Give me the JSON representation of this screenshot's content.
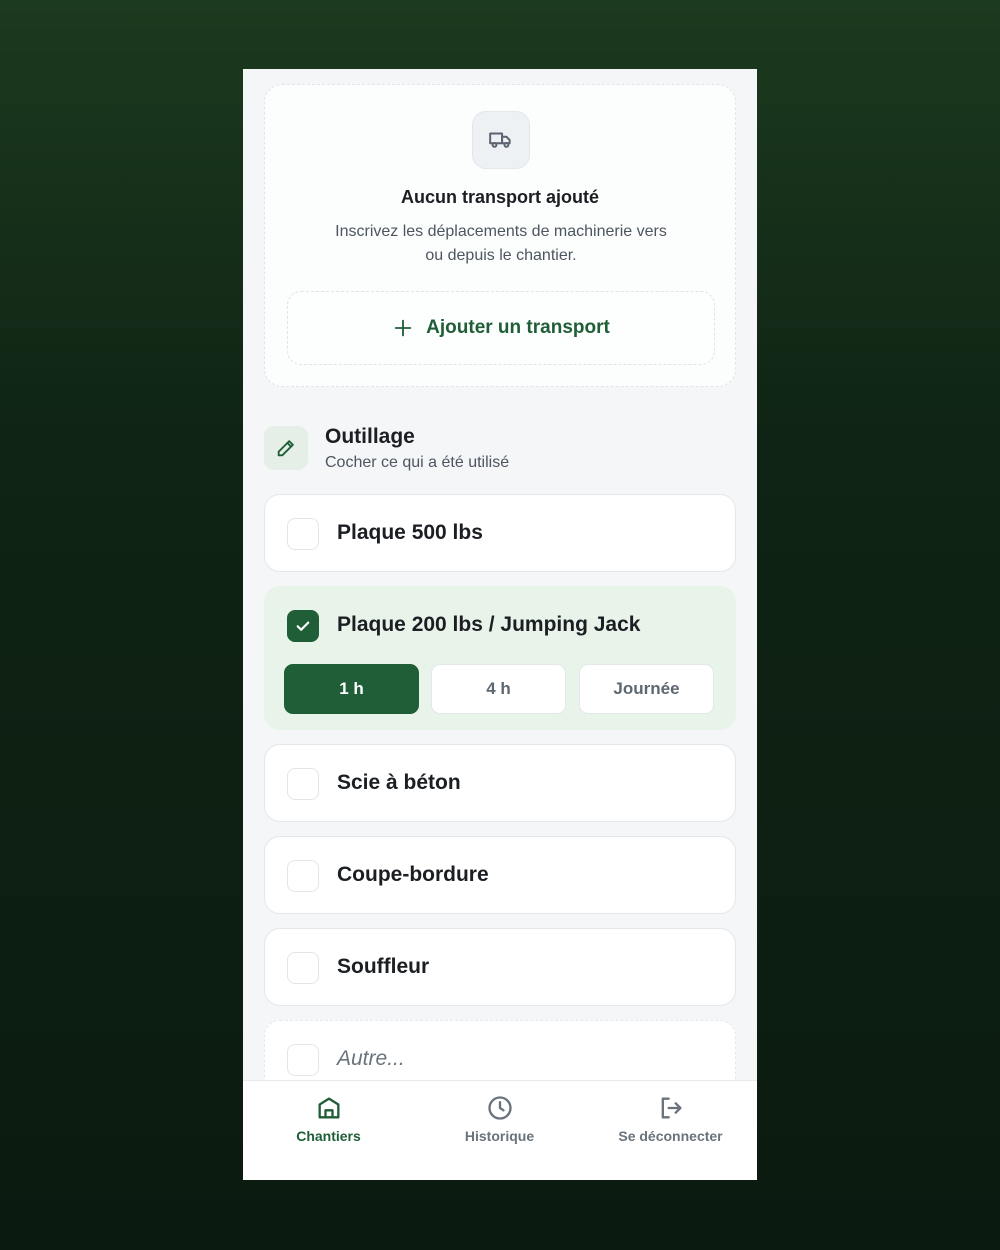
{
  "transport": {
    "empty_title": "Aucun transport ajouté",
    "empty_description": "Inscrivez les déplacements de machinerie vers ou depuis le chantier.",
    "add_button_label": "Ajouter un transport",
    "icon": "truck-icon"
  },
  "tools": {
    "title": "Outillage",
    "subtitle": "Cocher ce qui a été utilisé",
    "icon": "pencil-icon",
    "items": [
      {
        "label": "Plaque 500 lbs",
        "checked": false
      },
      {
        "label": "Plaque 200 lbs / Jumping Jack",
        "checked": true
      },
      {
        "label": "Scie à béton",
        "checked": false
      },
      {
        "label": "Coupe-bordure",
        "checked": false
      },
      {
        "label": "Souffleur",
        "checked": false
      }
    ],
    "other_placeholder": "Autre...",
    "durations": [
      "1 h",
      "4 h",
      "Journée"
    ],
    "selected_duration": "1 h"
  },
  "nav": {
    "items": [
      {
        "label": "Chantiers",
        "icon": "home-icon",
        "active": true
      },
      {
        "label": "Historique",
        "icon": "clock-icon",
        "active": false
      },
      {
        "label": "Se déconnecter",
        "icon": "logout-icon",
        "active": false
      }
    ]
  },
  "colors": {
    "primary": "#1f5e37",
    "selected_bg": "#e8f3ea",
    "app_bg": "#f4f6f8"
  }
}
